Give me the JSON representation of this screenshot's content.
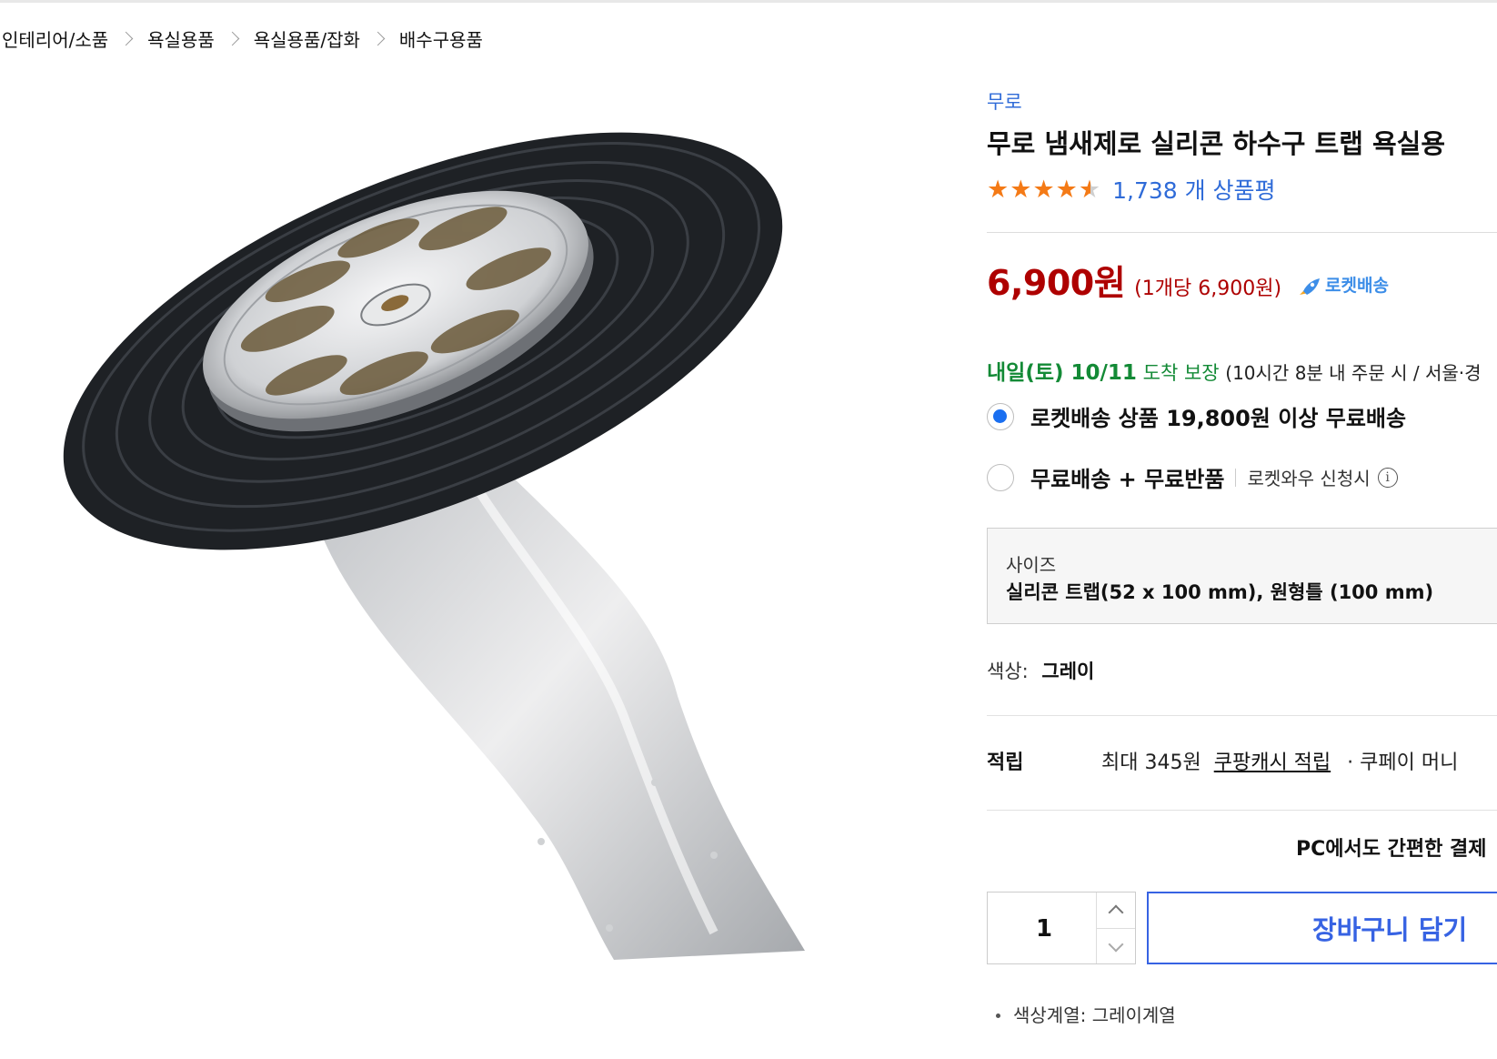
{
  "breadcrumb": [
    "인테리어/소품",
    "욕실용품",
    "욕실용품/잡화",
    "배수구용품"
  ],
  "product": {
    "brand": "무로",
    "title": "무로 냄새제로 실리콘 하수구 트랩 욕실용",
    "rating": 4.5,
    "review_count": "1,738 개 상품평",
    "price": "6,900원",
    "unit_price": "(1개당 6,900원)",
    "rocket_label": "로켓배송"
  },
  "delivery": {
    "date": "내일(토) 10/11",
    "guarantee": "도착 보장",
    "note": "(10시간 8분 내 주문 시 / 서울·경"
  },
  "shipping_options": [
    {
      "label": "로켓배송 상품 19,800원 이상 무료배송",
      "sub": "",
      "checked": true
    },
    {
      "label": "무료배송 + 무료반품",
      "sub": "로켓와우 신청시",
      "checked": false
    }
  ],
  "size_option": {
    "label": "사이즈",
    "value": "실리콘 트랩(52 x 100 mm), 원형틀 (100 mm)"
  },
  "color_option": {
    "label": "색상:",
    "value": "그레이"
  },
  "reward": {
    "title": "적립",
    "text": "최대 345원",
    "link": "쿠팡캐시 적립",
    "more": "· 쿠페이 머니"
  },
  "pay_banner": "PC에서도 간편한 결제",
  "quantity": "1",
  "cart_button": "장바구니 담기",
  "bottom_note": "색상계열: 그레이계열",
  "colors": {
    "price": "#ae0000",
    "link": "#2f6bd8",
    "delivery": "#138a36",
    "cart": "#3763e3",
    "star": "#f47a16"
  }
}
